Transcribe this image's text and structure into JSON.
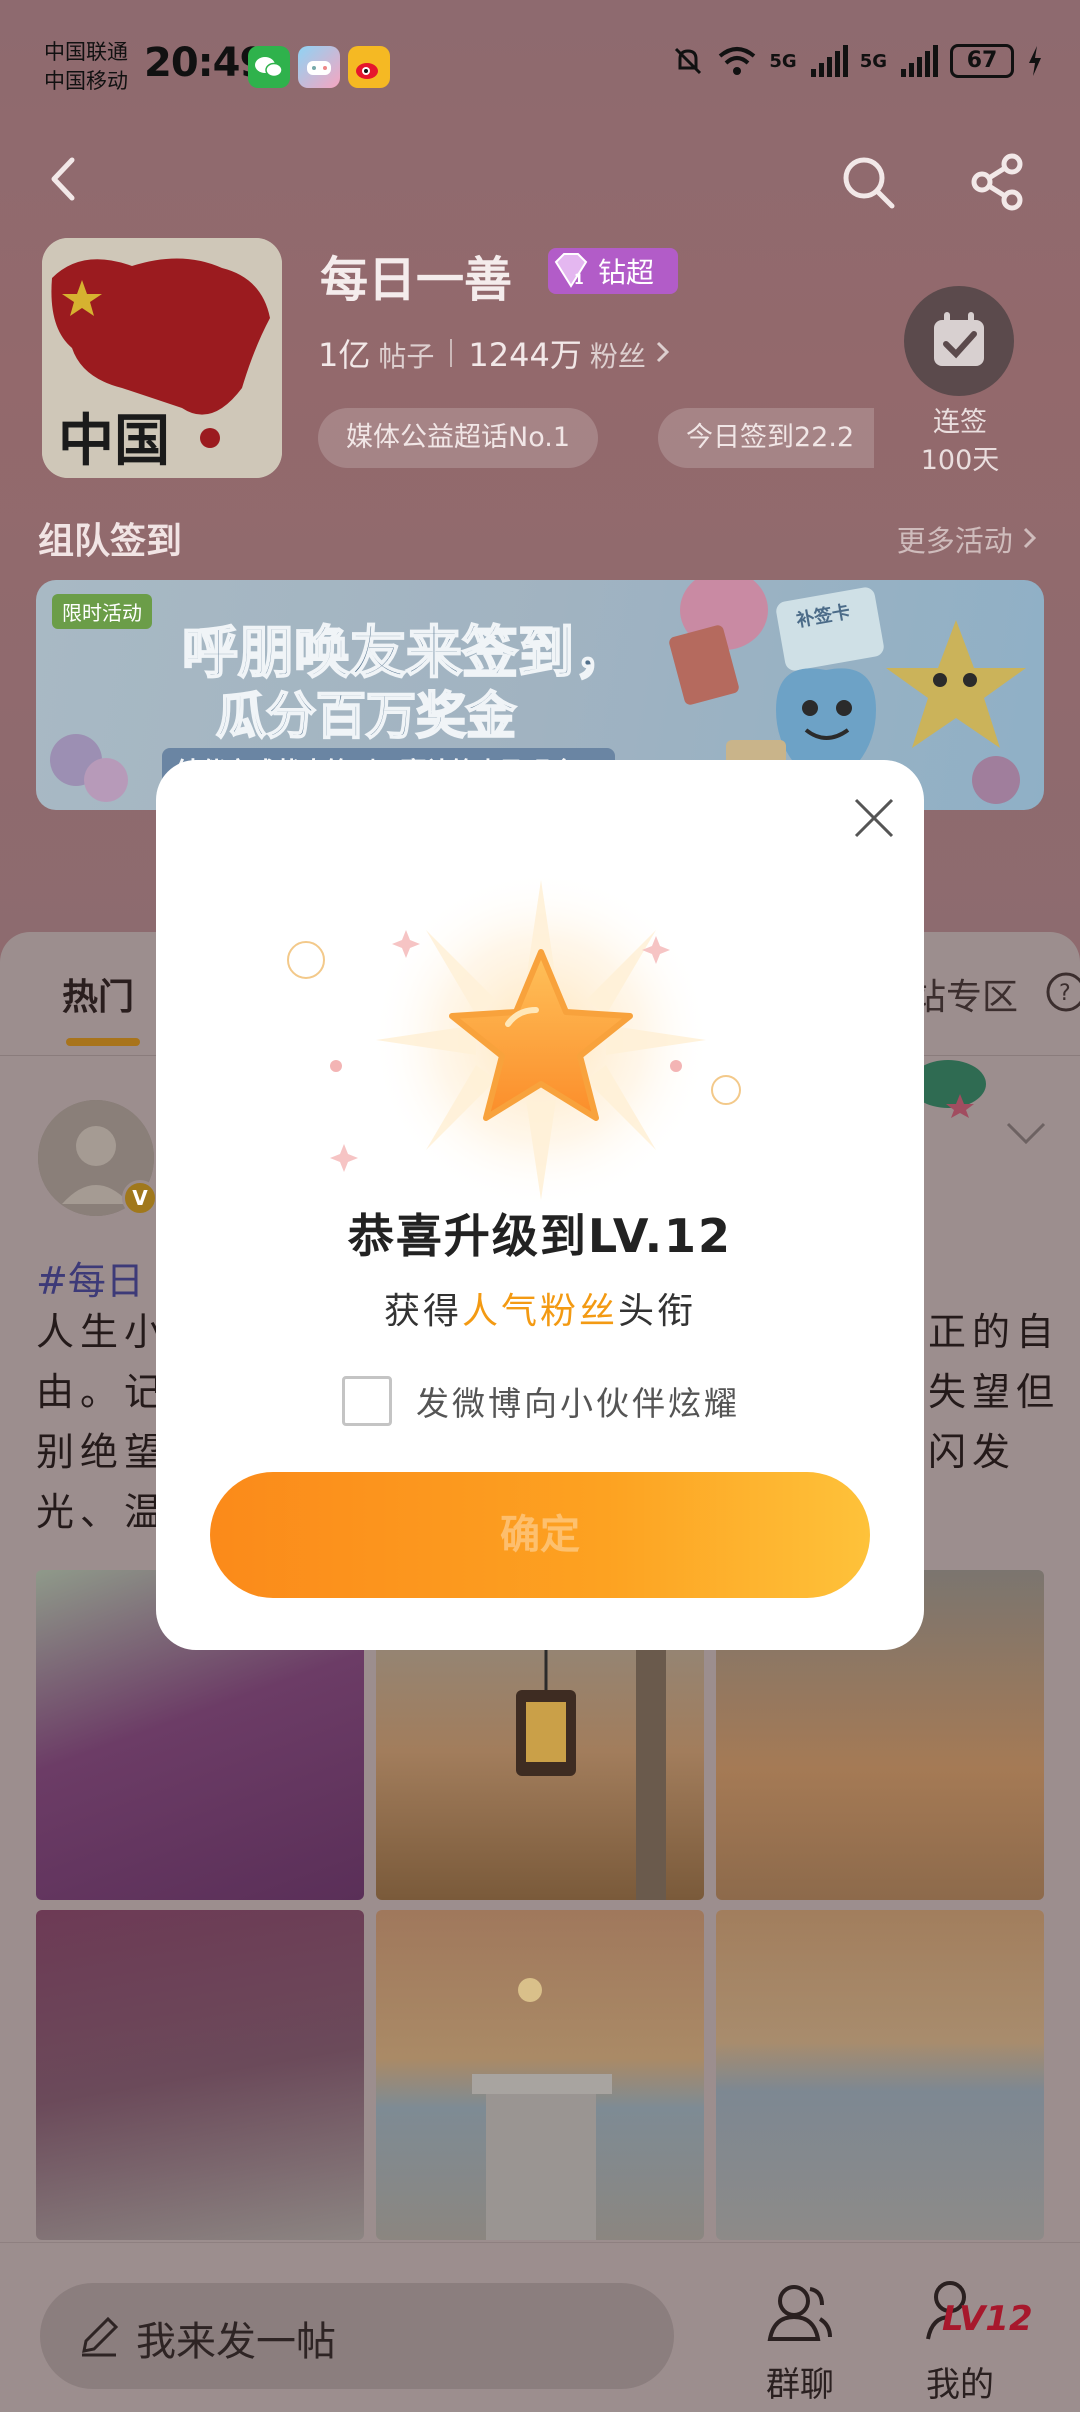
{
  "status_bar": {
    "carrier_1": "中国联通",
    "carrier_2": "中国移动",
    "time": "20:49",
    "network_1": "5G",
    "network_2": "5G",
    "battery": "67",
    "app_icons": [
      "wechat-icon",
      "game-icon",
      "weibo-icon"
    ]
  },
  "topic": {
    "title": "每日一善",
    "badge_label": "钻超",
    "avatar_text": "中国",
    "posts_count": "1亿",
    "posts_unit": "帖子",
    "fans_count": "1244万",
    "fans_unit": "粉丝",
    "chips": [
      "媒体公益超话No.1",
      "今日签到22.2"
    ],
    "checkin_label_1": "连签",
    "checkin_label_2": "100天"
  },
  "team_section": {
    "title": "组队签到",
    "more_link": "更多活动"
  },
  "banner": {
    "tag": "限时活动",
    "title_line1": "呼朋唤友来签到，",
    "title_line2": "瓜分百万奖金",
    "subtitle": "结伴完成状态签到，赢补签卡及现金，",
    "card_label": "补签卡"
  },
  "feed": {
    "tab_hot": "热门",
    "tab_zone": "站专区",
    "post_tag": "#每日",
    "post_lines_left": [
      "人生小",
      "由。记",
      "别绝望",
      "光、温"
    ],
    "post_lines_right": [
      "正的自",
      "失望但",
      "闪发",
      ""
    ]
  },
  "modal": {
    "title": "恭喜升级到LV.12",
    "subtitle_prefix": "获得",
    "subtitle_highlight": "人气粉丝",
    "subtitle_suffix": "头衔",
    "share_label": "发微博向小伙伴炫耀",
    "confirm_label": "确定"
  },
  "bottom_bar": {
    "compose_placeholder": "我来发一帖",
    "group_chat_label": "群聊",
    "mine_label": "我的",
    "level_mark": "LV12"
  },
  "colors": {
    "accent_orange": "#fb8a1a",
    "highlight_orange": "#f39a13",
    "badge_purple": "#b25cc8"
  }
}
